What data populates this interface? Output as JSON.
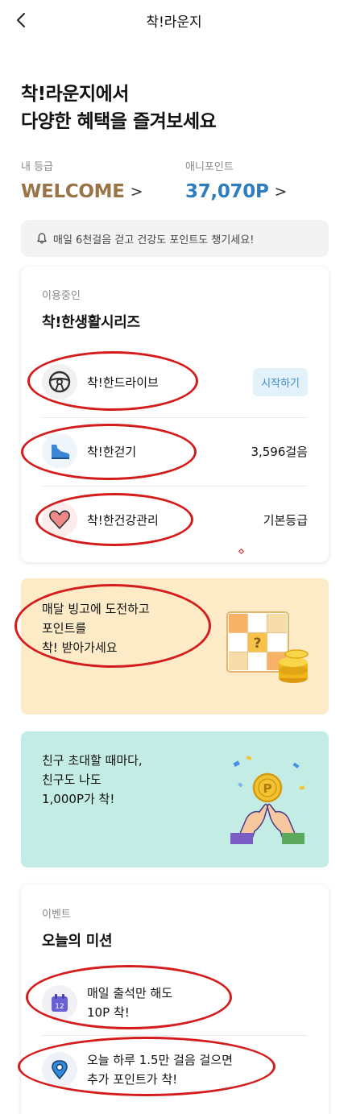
{
  "header": {
    "title": "착!라운지",
    "back_icon": "chevron-left-icon"
  },
  "hero": {
    "line1": "착!라운지에서",
    "line2": "다양한 혜택을 즐겨보세요"
  },
  "grade": {
    "label": "내 등급",
    "value": "WELCOME",
    "color": "#9a7346"
  },
  "points": {
    "label": "애니포인트",
    "value": "37,070P",
    "color": "#2e7dbf"
  },
  "chevron_right": ">",
  "notice": {
    "icon": "bell-icon",
    "text": "매일 6천걸음 걷고 건강도 포인트도 챙기세요!"
  },
  "series": {
    "subtitle": "이용중인",
    "title": "착!한생활시리즈",
    "items": [
      {
        "icon": "steering-wheel-icon",
        "label": "착!한드라이브",
        "action": "시작하기"
      },
      {
        "icon": "sneaker-icon",
        "label": "착!한걷기",
        "value": "3,596걸음"
      },
      {
        "icon": "heart-icon",
        "label": "착!한건강관리",
        "value": "기본등급"
      }
    ]
  },
  "bingo_banner": {
    "line1": "매달 빙고에 도전하고",
    "line2": "포인트를",
    "line3": "착! 받아가세요",
    "bg_color": "#fdebc8",
    "icon": "bingo-board-coins-icon",
    "question_mark": "?"
  },
  "friend_banner": {
    "line1": "친구 초대할 때마다,",
    "line2": "친구도 나도",
    "line3": "1,000P가 착!",
    "bg_color": "#c3ece4",
    "icon": "pinky-promise-coin-icon",
    "coin_letter": "P"
  },
  "missions": {
    "subtitle": "이벤트",
    "title": "오늘의 미션",
    "items": [
      {
        "icon": "calendar-icon",
        "badge": "12",
        "line1": "매일 출석만 해도",
        "line2": "10P 착!"
      },
      {
        "icon": "location-pin-icon",
        "line1": "오늘 하루 1.5만 걸음 걸으면",
        "line2": "추가 포인트가 착!"
      }
    ]
  },
  "annotation_color": "#d51c1c"
}
